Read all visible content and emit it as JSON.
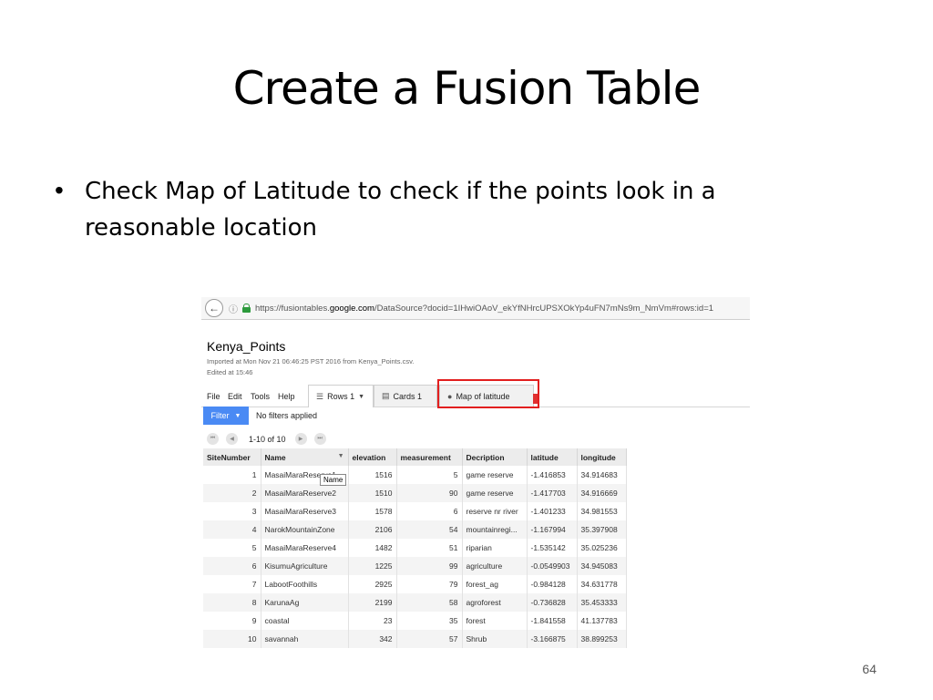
{
  "slide": {
    "title": "Create a Fusion Table",
    "bullet": "Check Map of Latitude to check if the points look in a reasonable location",
    "page_number": "64"
  },
  "browser": {
    "url_prefix": "https://fusiontables.",
    "url_domain": "google.com",
    "url_suffix": "/DataSource?docid=1IHwiOAoV_ekYfNHrcUPSXOkYp4uFN7mNs9m_NmVm#rows:id=1"
  },
  "fusion": {
    "title": "Kenya_Points",
    "imported": "Imported at Mon Nov 21 06:46:25 PST 2016 from Kenya_Points.csv.",
    "edited": "Edited at 15:46",
    "menu": [
      "File",
      "Edit",
      "Tools",
      "Help"
    ],
    "tabs": {
      "rows": "Rows 1",
      "cards": "Cards 1",
      "map": "Map of latitude"
    },
    "filter_label": "Filter",
    "no_filters": "No filters applied",
    "pagination": "1-10 of 10",
    "tooltip": "Name",
    "columns": [
      "SiteNumber",
      "Name",
      "elevation",
      "measurement",
      "Decription",
      "latitude",
      "longitude"
    ],
    "rows": [
      [
        "1",
        "MasaiMaraReserve1",
        "1516",
        "5",
        "game reserve",
        "-1.416853",
        "34.914683"
      ],
      [
        "2",
        "MasaiMaraReserve2",
        "1510",
        "90",
        "game reserve",
        "-1.417703",
        "34.916669"
      ],
      [
        "3",
        "MasaiMaraReserve3",
        "1578",
        "6",
        "reserve nr river",
        "-1.401233",
        "34.981553"
      ],
      [
        "4",
        "NarokMountainZone",
        "2106",
        "54",
        "mountainregi...",
        "-1.167994",
        "35.397908"
      ],
      [
        "5",
        "MasaiMaraReserve4",
        "1482",
        "51",
        "riparian",
        "-1.535142",
        "35.025236"
      ],
      [
        "6",
        "KisumuAgriculture",
        "1225",
        "99",
        "agriculture",
        "-0.0549903",
        "34.945083"
      ],
      [
        "7",
        "LabootFoothills",
        "2925",
        "79",
        "forest_ag",
        "-0.984128",
        "34.631778"
      ],
      [
        "8",
        "KarunaAg",
        "2199",
        "58",
        "agroforest",
        "-0.736828",
        "35.453333"
      ],
      [
        "9",
        "coastal",
        "23",
        "35",
        "forest",
        "-1.841558",
        "41.137783"
      ],
      [
        "10",
        "savannah",
        "342",
        "57",
        "Shrub",
        "-3.166875",
        "38.899253"
      ]
    ]
  }
}
